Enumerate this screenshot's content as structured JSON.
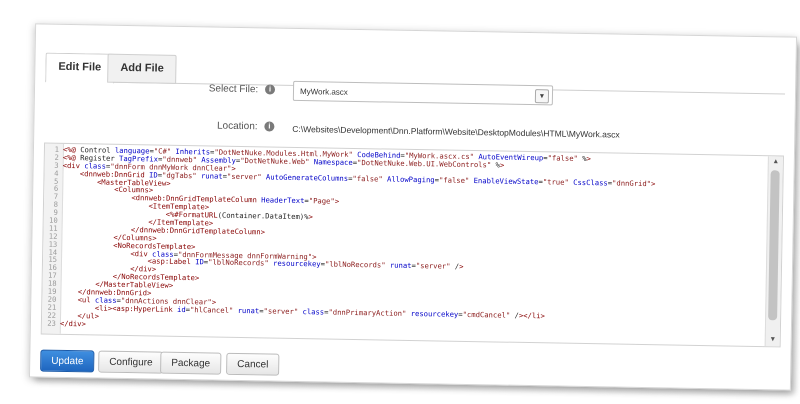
{
  "tabs": [
    {
      "label": "Edit File",
      "active": true
    },
    {
      "label": "Add File",
      "active": false
    }
  ],
  "form": {
    "select_file_label": "Select File:",
    "select_file_value": "MyWork.ascx",
    "location_label": "Location:",
    "location_value": "C:\\Websites\\Development\\Dnn.Platform\\Website\\DesktopModules\\HTML\\MyWork.ascx"
  },
  "code_lines": [
    "<%@ Control language=\"C#\" Inherits=\"DotNetNuke.Modules.Html.MyWork\" CodeBehind=\"MyWork.ascx.cs\" AutoEventWireup=\"false\" %>",
    "<%@ Register TagPrefix=\"dnnweb\" Assembly=\"DotNetNuke.Web\" Namespace=\"DotNetNuke.Web.UI.WebControls\" %>",
    "<div class=\"dnnForm dnnMyWork dnnClear\">",
    "    <dnnweb:DnnGrid ID=\"dgTabs\" runat=\"server\" AutoGenerateColumns=\"false\" AllowPaging=\"false\" EnableViewState=\"true\" CssClass=\"dnnGrid\">",
    "        <MasterTableView>",
    "            <Columns>",
    "                <dnnweb:DnnGridTemplateColumn HeaderText=\"Page\">",
    "                    <ItemTemplate>",
    "                        <%#FormatURL(Container.DataItem)%>",
    "                    </ItemTemplate>",
    "                </dnnweb:DnnGridTemplateColumn>",
    "            </Columns>",
    "            <NoRecordsTemplate>",
    "                <div class=\"dnnFormMessage dnnFormWarning\">",
    "                    <asp:Label ID=\"lblNoRecords\" resourcekey=\"lblNoRecords\" runat=\"server\" />",
    "                </div>",
    "            </NoRecordsTemplate>",
    "        </MasterTableView>",
    "    </dnnweb:DnnGrid>",
    "    <ul class=\"dnnActions dnnClear\">",
    "        <li><asp:HyperLink id=\"hlCancel\" runat=\"server\" class=\"dnnPrimaryAction\" resourcekey=\"cmdCancel\" /></li>",
    "    </ul>",
    "</div>"
  ],
  "buttons": {
    "update": "Update",
    "configure": "Configure",
    "package": "Package",
    "cancel": "Cancel"
  },
  "colors": {
    "primary": "#2a78d2",
    "tag": "#870000",
    "attribute": "#0000c8"
  }
}
